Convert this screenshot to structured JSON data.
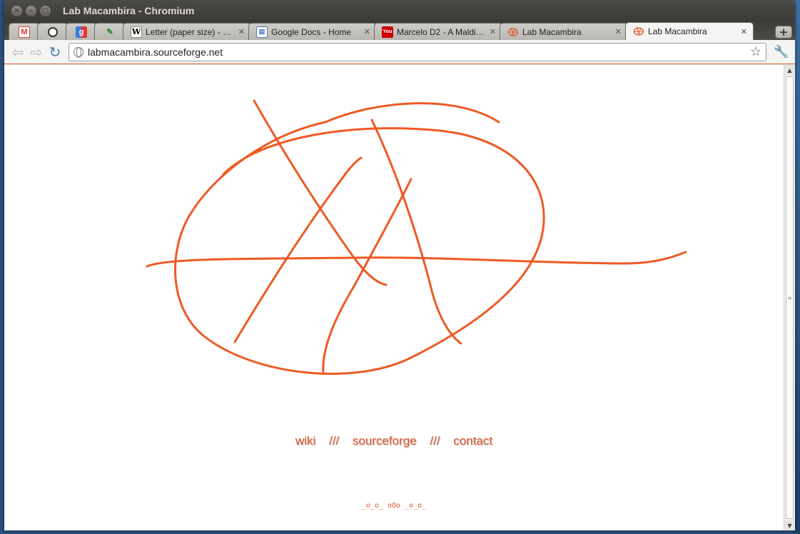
{
  "window": {
    "title": "Lab Macambira - Chromium"
  },
  "tabs": [
    {
      "label": "",
      "icon": "gmail-icon"
    },
    {
      "label": "",
      "icon": "reader-icon"
    },
    {
      "label": "",
      "icon": "google-icon"
    },
    {
      "label": "",
      "icon": "pen-icon"
    },
    {
      "label": "Letter (paper size) - …",
      "icon": "wikipedia-icon"
    },
    {
      "label": "Google Docs - Home",
      "icon": "docs-icon"
    },
    {
      "label": "Marcelo D2 - A Maldi…",
      "icon": "youtube-icon"
    },
    {
      "label": "Lab Macambira",
      "icon": "macambira-icon"
    },
    {
      "label": "Lab Macambira",
      "icon": "macambira-icon",
      "active": true
    }
  ],
  "toolbar": {
    "url": "labmacambira.sourceforge.net"
  },
  "page": {
    "links": [
      "wiki",
      "sourceforge",
      "contact"
    ],
    "separator": "///",
    "footer": "_o_o_ oOo _o_o_"
  },
  "colors": {
    "accent": "#e0552a",
    "logo_stroke": "#ee5a24"
  }
}
